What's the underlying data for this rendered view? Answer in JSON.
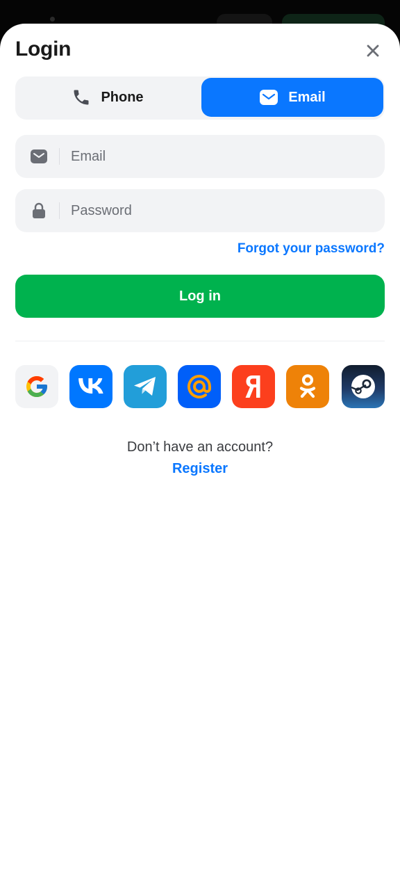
{
  "dialog": {
    "title": "Login"
  },
  "tabs": {
    "phone_label": "Phone",
    "email_label": "Email",
    "selected": "Email"
  },
  "fields": {
    "email_placeholder": "Email",
    "password_placeholder": "Password"
  },
  "links": {
    "forgot_password": "Forgot your password?",
    "register": "Register"
  },
  "buttons": {
    "login": "Log in"
  },
  "footer": {
    "no_account_text": "Don’t have an account?"
  },
  "social_providers": [
    {
      "name": "google-icon",
      "color": "#f2f3f5"
    },
    {
      "name": "vk-icon",
      "color": "#0077ff"
    },
    {
      "name": "telegram-icon",
      "color": "#229ed9"
    },
    {
      "name": "mail-ru-icon",
      "color": "#005ff9"
    },
    {
      "name": "yandex-icon",
      "color": "#fc3f1d"
    },
    {
      "name": "odnoklassniki-icon",
      "color": "#ee8208"
    },
    {
      "name": "steam-icon",
      "color": "#1b2838"
    }
  ],
  "colors": {
    "accent_blue": "#0a77ff",
    "login_green": "#00b24e",
    "field_bg": "#f2f3f5"
  }
}
